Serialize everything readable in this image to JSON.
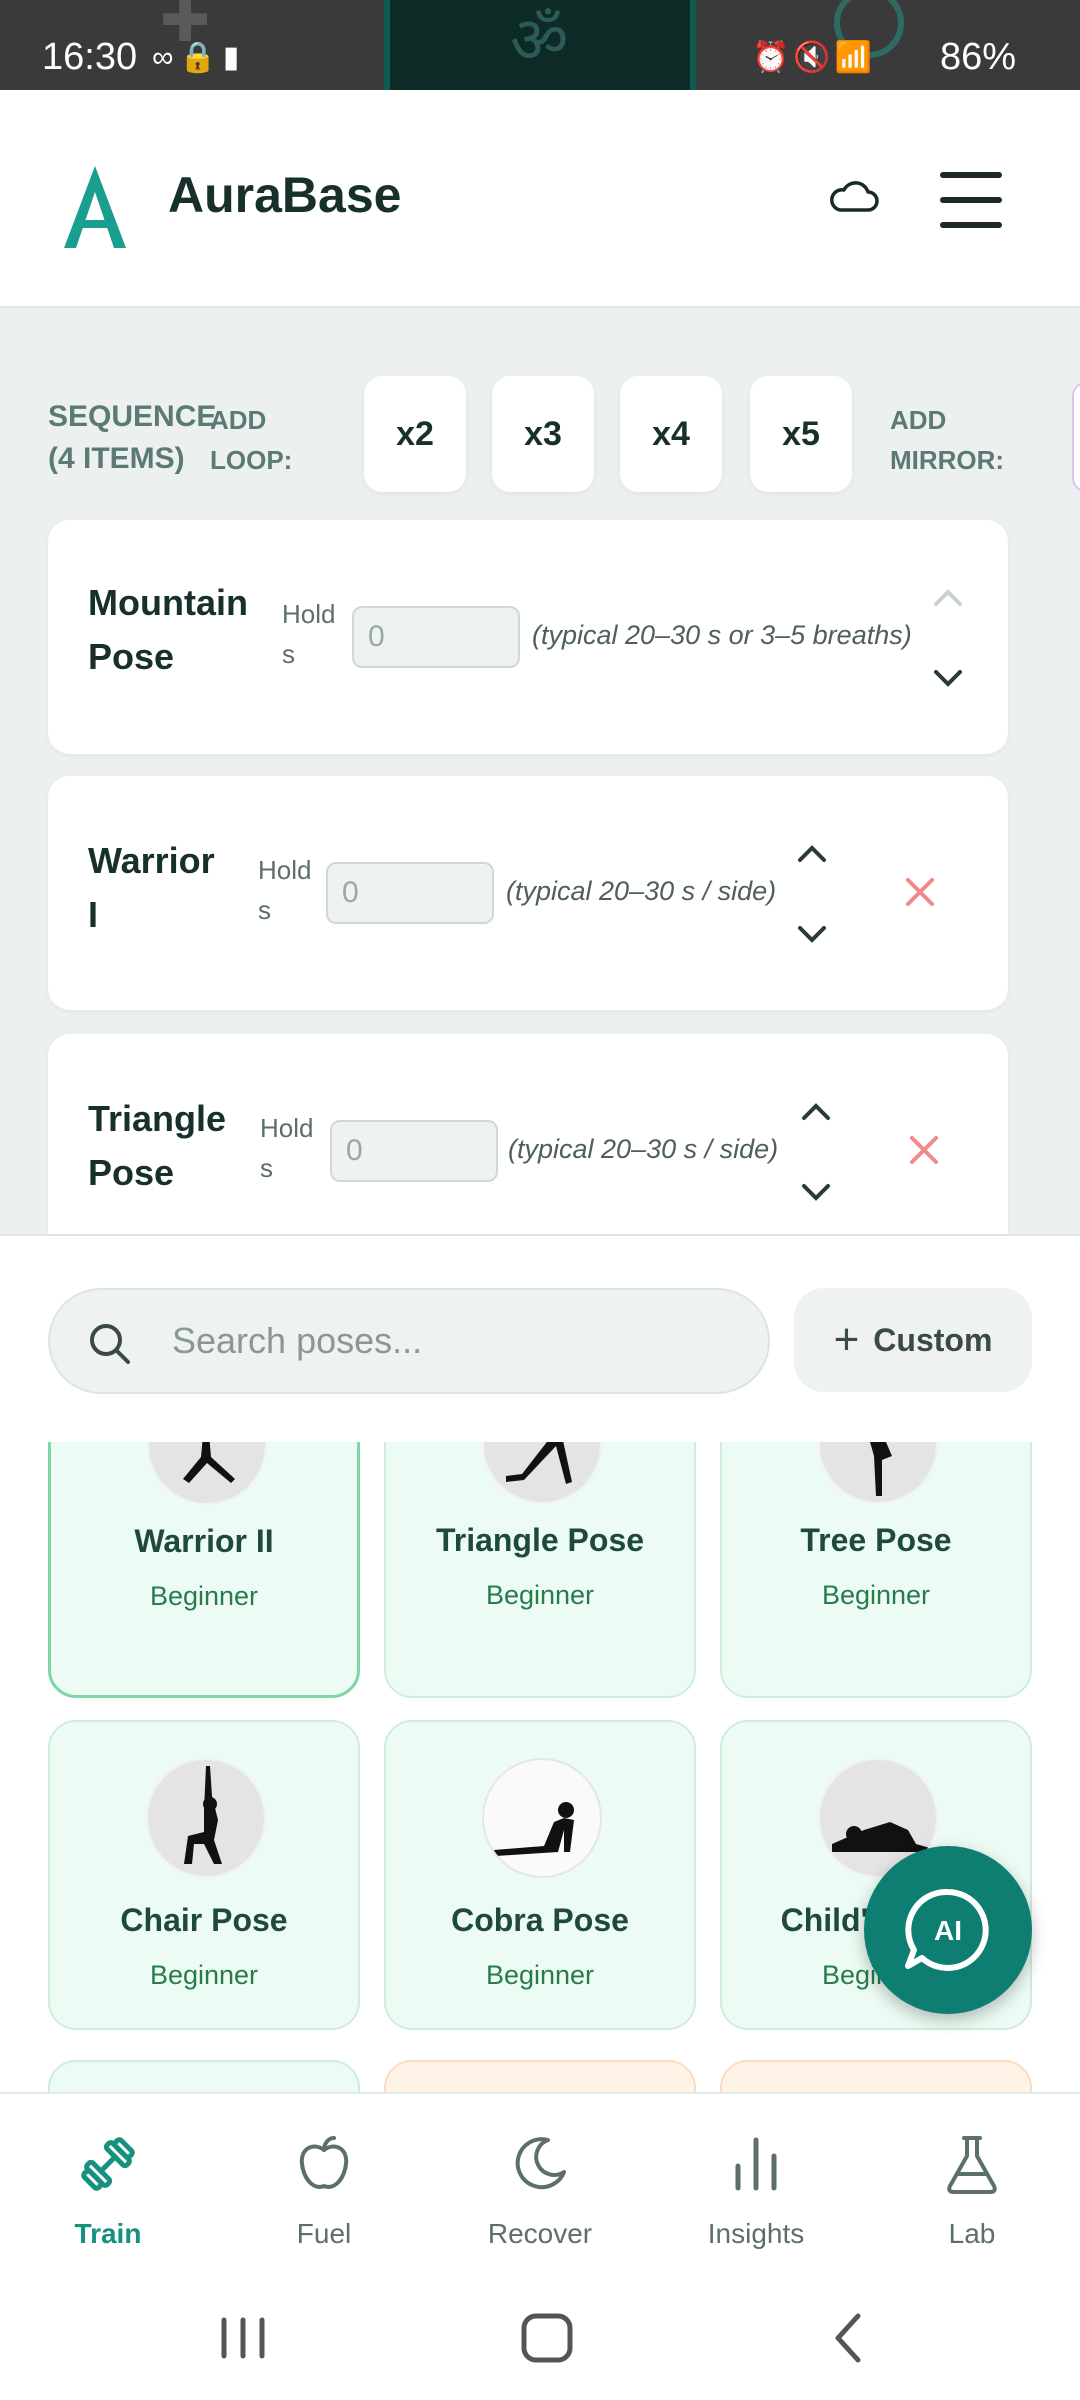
{
  "status_bar": {
    "time": "16:30",
    "battery": "86%"
  },
  "header": {
    "app_name": "AuraBase"
  },
  "sequence": {
    "title_line1": "SEQUENCE",
    "title_line2": "(4 ITEMS)",
    "add_loop_line1": "ADD",
    "add_loop_line2": "LOOP:",
    "loop_buttons": [
      "x2",
      "x3",
      "x4",
      "x5"
    ],
    "add_mirror_line1": "ADD",
    "add_mirror_line2": "MIRROR:",
    "items": [
      {
        "name_line1": "Mountain",
        "name_line2": "Pose",
        "hold_line1": "Hold",
        "hold_line2": "s",
        "hold_value": "0",
        "hint": "(typical 20–30 s or 3–5 breaths)"
      },
      {
        "name_line1": "Warrior",
        "name_line2": "I",
        "hold_line1": "Hold",
        "hold_line2": "s",
        "hold_value": "0",
        "hint": "(typical 20–30 s / side)"
      },
      {
        "name_line1": "Triangle",
        "name_line2": "Pose",
        "hold_line1": "Hold",
        "hold_line2": "s",
        "hold_value": "0",
        "hint": "(typical 20–30 s / side)"
      }
    ]
  },
  "search": {
    "placeholder": "Search poses...",
    "custom_label": "Custom"
  },
  "poses": [
    {
      "name": "Warrior II",
      "level": "Beginner",
      "selected": true
    },
    {
      "name": "Triangle Pose",
      "level": "Beginner"
    },
    {
      "name": "Tree Pose",
      "level": "Beginner"
    },
    {
      "name": "Chair Pose",
      "level": "Beginner"
    },
    {
      "name": "Cobra Pose",
      "level": "Beginner"
    },
    {
      "name": "Child's Pose",
      "level": "Beginner"
    }
  ],
  "ai_button": {
    "label": "AI"
  },
  "bottom_nav": [
    {
      "label": "Train",
      "icon": "dumbbell-icon",
      "active": true
    },
    {
      "label": "Fuel",
      "icon": "apple-icon"
    },
    {
      "label": "Recover",
      "icon": "moon-icon"
    },
    {
      "label": "Insights",
      "icon": "bar-chart-icon"
    },
    {
      "label": "Lab",
      "icon": "flask-icon"
    }
  ],
  "colors": {
    "accent": "#15917f",
    "card_green": "#ecfbf3",
    "fab": "#0e7e72",
    "remove": "#f08a8a"
  }
}
